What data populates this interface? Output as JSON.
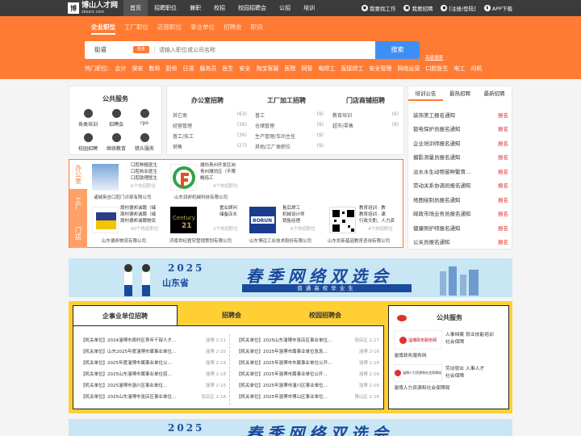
{
  "header": {
    "logo_title": "博山人才网",
    "logo_sub": "zbsarc.com",
    "nav": [
      "首页",
      "招聘职位",
      "兼职",
      "校招",
      "校园招聘会",
      "公招",
      "培训"
    ],
    "links": [
      "我要找工作",
      "我要招聘",
      "[注册/登陆]",
      "APP下载"
    ]
  },
  "search": {
    "tabs": [
      "企业职位",
      "工厂职位",
      "店面职位",
      "事业单位",
      "招聘会",
      "职讯"
    ],
    "city": "街道",
    "change": "更多",
    "placeholder": "请输入职位或公司名称",
    "button": "搜索",
    "advanced": "高级搜索",
    "hot_label": "热门职位:",
    "hot": [
      "会计",
      "保安",
      "教师",
      "厨师",
      "日语",
      "服务员",
      "医生",
      "安全",
      "淘宝客服",
      "医院",
      "网管",
      "电焊工",
      "直接焊工",
      "安全管理",
      "网络运营",
      "口腔医生",
      "电工",
      "司机"
    ]
  },
  "public_service": {
    "title": "公共服务",
    "items": [
      "各类培训",
      "招聘会",
      "rpo",
      "校园招聘",
      "继续教育",
      "猎头服务"
    ]
  },
  "columns": [
    {
      "title": "办公室招聘",
      "rows": [
        [
          "其它类",
          "(63)"
        ],
        [
          "经营管理",
          "(36)"
        ],
        [
          "普工/技工",
          "(36)"
        ],
        [
          "销售",
          "(27)"
        ]
      ]
    },
    {
      "title": "工厂加工招聘",
      "rows": [
        [
          "普工",
          "(9)"
        ],
        [
          "仓储管理",
          "(9)"
        ],
        [
          "生产管理/车间主任",
          "(9)"
        ],
        [
          "其他/工厂类职位",
          "(9)"
        ]
      ]
    },
    {
      "title": "门店商铺招聘",
      "rows": [
        [
          "教育培训",
          "(6)"
        ],
        [
          "超市/零售",
          "(9)"
        ],
        [
          "",
          ""
        ],
        [
          "",
          ""
        ]
      ]
    }
  ],
  "side_tabs": [
    "培训公告",
    "最热招聘",
    "最新招聘"
  ],
  "announcements": [
    [
      "装饰美工报名通知",
      "报名"
    ],
    [
      "锻电保护员报名通知",
      "报名"
    ],
    [
      "企业培训师报名通知",
      "报名"
    ],
    [
      "摄影测量员报名通知",
      "报名"
    ],
    [
      "淡水水生动物苗种繁育...",
      "报名"
    ],
    [
      "劳动关系协调员报名通知",
      "报名"
    ],
    [
      "地图绘制员报名通知",
      "报名"
    ],
    [
      "邮政市场业务员报名通知",
      "报名"
    ],
    [
      "健康照护师报名通知",
      "报名"
    ],
    [
      "公关员报名通知",
      "报名"
    ]
  ],
  "vtabs": [
    "办公室",
    "工厂",
    "门店"
  ],
  "companies": [
    {
      "name": "诸城英吉口腔门诊部有限公司",
      "jobs": "口腔种植医生\n口腔执业医生\n口腔助理医生",
      "count": "6个热招职位"
    },
    {
      "name": "山东润邦机械科技有限公司",
      "jobs": "潍坊青州开发区岗\n青州潍坊区（不限\n概括工",
      "count": "4个热招职位"
    },
    {
      "name": "山东德邦物流有限公司",
      "jobs": "周村德邦诚聘（储\n周村德邦诚聘（储\n周村德邦诚聘物流",
      "count": "40个热招职位"
    },
    {
      "name": "济南世纪君安管销策划有限公司",
      "jobs": "置业顾问\n储备店长",
      "count": "2个热招职位"
    },
    {
      "name": "山东博远工业技术股份有限公司",
      "jobs": "售后焊工\n机械设计师\n销售经理",
      "count": "6个热招职位"
    },
    {
      "name": "山东炬新基因教育咨询有限公司",
      "jobs": "教育培训 · 教\n教育培训 · 课\n行政文职、人力资",
      "count": "4个热招职位"
    }
  ],
  "banner": {
    "year": "2025",
    "province": "山东省",
    "main": "春季网络双选会",
    "sub": "普通高校毕业生"
  },
  "lower_tabs": [
    "企事业单位招聘",
    "招聘会",
    "校园招聘会"
  ],
  "jobs_left": [
    [
      "【机关单位】2024淄博市周村区青年干部人才...",
      "淄博",
      "2-21"
    ],
    [
      "【机关单位】山东2025年度淄博市属事业单位...",
      "淄博",
      "2-20"
    ],
    [
      "【机关单位】2025年度淄博市属事业单位公...",
      "淄博",
      "2-19"
    ],
    [
      "【机关单位】2025山东淄博市属事业单位招...",
      "淄博",
      "2-18"
    ],
    [
      "【机关单位】2025淄博市淄川区事业单位...",
      "淄博",
      "2-16"
    ],
    [
      "【机关单位】2025山东淄博市张店区事业单位...",
      "张店区",
      "2-18"
    ]
  ],
  "jobs_right": [
    [
      "【机关单位】2025山东淄博市张店区事业单位...",
      "张店区",
      "2-17"
    ],
    [
      "【机关单位】2025年淄博市属事业单位急急...",
      "淄博",
      "2-16"
    ],
    [
      "【机关单位】2025年淄博市市属事业单位公开...",
      "淄博",
      "2-16"
    ],
    [
      "【机关单位】2025年淄博市属事业单位公开...",
      "淄博",
      "2-16"
    ],
    [
      "【机关单位】2025年淄博市淄川区事业单位...",
      "淄博",
      "2-16"
    ],
    [
      "【机关单位】2025年淄博市博山区事业单位...",
      "博山区",
      "2-16"
    ]
  ],
  "public_service2": {
    "title": "公共服务",
    "items": [
      {
        "caption": "淄博政务服务网",
        "text": "人事档案  就业技能培训\n社会保障"
      },
      {
        "caption": "淄博人力资源和社会保障局",
        "text": "劳动就业  人事人才\n社会保障"
      }
    ]
  },
  "colors": {
    "accent": "#ff7b33",
    "topbar": "#3b3b3b",
    "button": "#3d8ff5",
    "yellow": "#ffcf33",
    "red": "#e23030"
  }
}
